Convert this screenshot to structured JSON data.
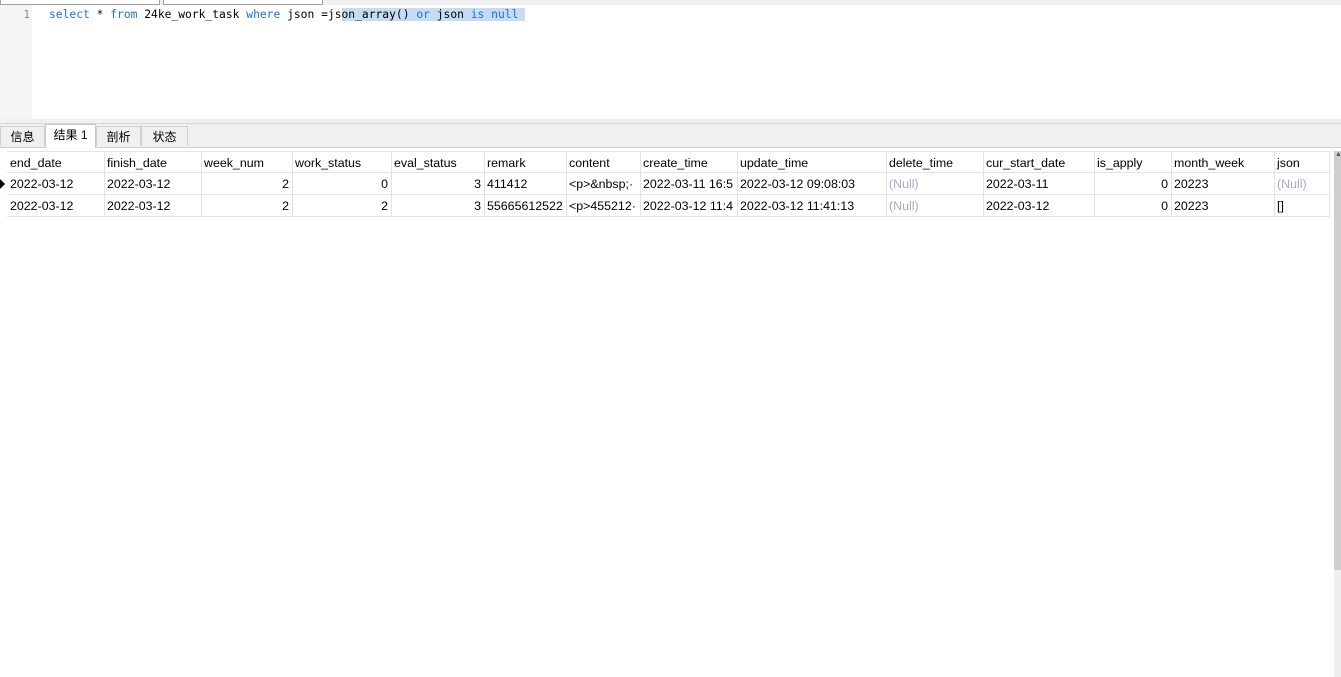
{
  "editor": {
    "line_number": "1",
    "query_parts": {
      "kw_select": "select",
      "star": " * ",
      "kw_from": "from",
      "table": " 24ke_work_task ",
      "kw_where": "where",
      "cond_a": " json =js",
      "sel_func": "on_array()",
      "sel_sp1": " ",
      "sel_kw_or": "or",
      "sel_json": " json ",
      "sel_kw_is": "is",
      "sel_sp2": " ",
      "sel_kw_null": "null",
      "sel_tail": " "
    },
    "query_full": "select * from 24ke_work_task where json =json_array() or json is null"
  },
  "tabs": [
    {
      "label": "信息",
      "active": false
    },
    {
      "label": "结果 1",
      "active": true
    },
    {
      "label": "剖析",
      "active": false
    },
    {
      "label": "状态",
      "active": false
    }
  ],
  "grid": {
    "columns": [
      "end_date",
      "finish_date",
      "week_num",
      "work_status",
      "eval_status",
      "remark",
      "content",
      "create_time",
      "update_time",
      "delete_time",
      "cur_start_date",
      "is_apply",
      "month_week",
      "json"
    ],
    "rows": [
      [
        "2022-03-12",
        "2022-03-12",
        "2",
        "0",
        "3",
        "411412",
        "<p>&nbsp;·",
        "2022-03-11 16:5",
        "2022-03-12 09:08:03",
        "(Null)",
        "2022-03-11",
        "0",
        "20223",
        "(Null)"
      ],
      [
        "2022-03-12",
        "2022-03-12",
        "2",
        "2",
        "3",
        "55665612522",
        "<p>455212·",
        "2022-03-12 11:4",
        "2022-03-12 11:41:13",
        "(Null)",
        "2022-03-12",
        "0",
        "20223",
        "[]"
      ]
    ],
    "current_row": 0
  }
}
